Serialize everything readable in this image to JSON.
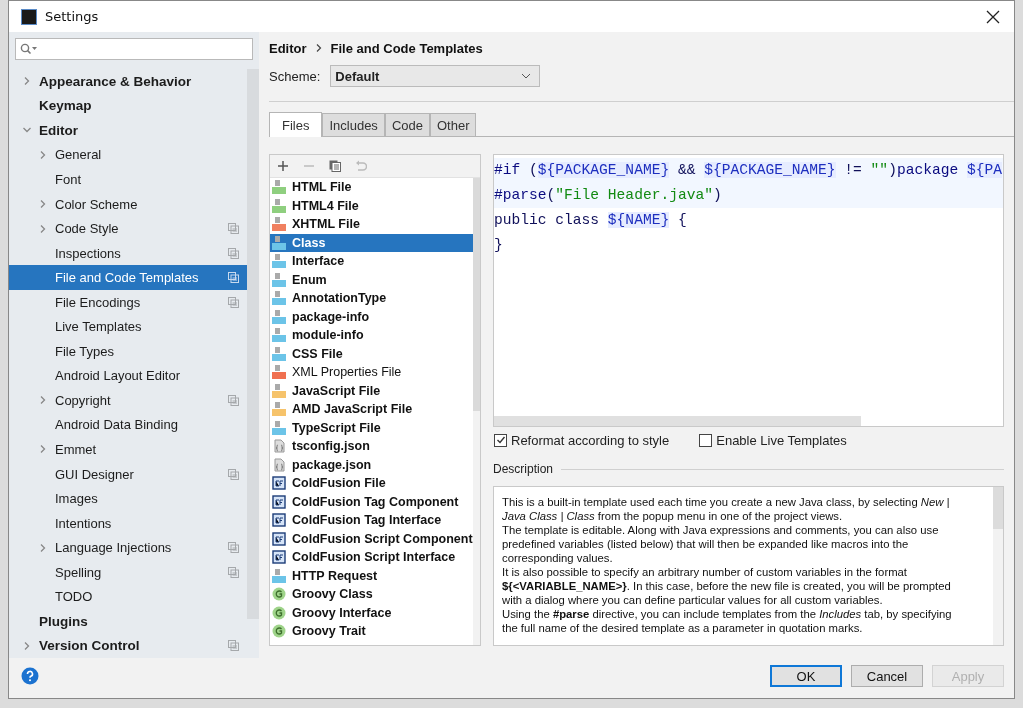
{
  "window": {
    "title": "Settings"
  },
  "sidebar": {
    "items": [
      {
        "label": "Appearance & Behavior",
        "kind": "group",
        "expanded": false,
        "bold": true,
        "project_level": false,
        "selected": false
      },
      {
        "label": "Keymap",
        "kind": "leaf",
        "bold": true,
        "project_level": false,
        "selected": false
      },
      {
        "label": "Editor",
        "kind": "group",
        "expanded": true,
        "bold": true,
        "project_level": false,
        "selected": false,
        "children": [
          {
            "label": "General",
            "kind": "group",
            "expanded": false,
            "bold": false,
            "project_level": false,
            "selected": false
          },
          {
            "label": "Font",
            "kind": "leaf",
            "bold": false,
            "project_level": false,
            "selected": false
          },
          {
            "label": "Color Scheme",
            "kind": "group",
            "expanded": false,
            "bold": false,
            "project_level": false,
            "selected": false
          },
          {
            "label": "Code Style",
            "kind": "group",
            "expanded": false,
            "bold": false,
            "project_level": true,
            "selected": false
          },
          {
            "label": "Inspections",
            "kind": "leaf",
            "bold": false,
            "project_level": true,
            "selected": false
          },
          {
            "label": "File and Code Templates",
            "kind": "leaf",
            "bold": false,
            "project_level": true,
            "selected": true
          },
          {
            "label": "File Encodings",
            "kind": "leaf",
            "bold": false,
            "project_level": true,
            "selected": false
          },
          {
            "label": "Live Templates",
            "kind": "leaf",
            "bold": false,
            "project_level": false,
            "selected": false
          },
          {
            "label": "File Types",
            "kind": "leaf",
            "bold": false,
            "project_level": false,
            "selected": false
          },
          {
            "label": "Android Layout Editor",
            "kind": "leaf",
            "bold": false,
            "project_level": false,
            "selected": false
          },
          {
            "label": "Copyright",
            "kind": "group",
            "expanded": false,
            "bold": false,
            "project_level": true,
            "selected": false
          },
          {
            "label": "Android Data Binding",
            "kind": "leaf",
            "bold": false,
            "project_level": false,
            "selected": false
          },
          {
            "label": "Emmet",
            "kind": "group",
            "expanded": false,
            "bold": false,
            "project_level": false,
            "selected": false
          },
          {
            "label": "GUI Designer",
            "kind": "leaf",
            "bold": false,
            "project_level": true,
            "selected": false
          },
          {
            "label": "Images",
            "kind": "leaf",
            "bold": false,
            "project_level": false,
            "selected": false
          },
          {
            "label": "Intentions",
            "kind": "leaf",
            "bold": false,
            "project_level": false,
            "selected": false
          },
          {
            "label": "Language Injections",
            "kind": "group",
            "expanded": false,
            "bold": false,
            "project_level": true,
            "selected": false
          },
          {
            "label": "Spelling",
            "kind": "leaf",
            "bold": false,
            "project_level": true,
            "selected": false
          },
          {
            "label": "TODO",
            "kind": "leaf",
            "bold": false,
            "project_level": false,
            "selected": false
          }
        ]
      },
      {
        "label": "Plugins",
        "kind": "leaf",
        "bold": true,
        "project_level": false,
        "selected": false
      },
      {
        "label": "Version Control",
        "kind": "group",
        "expanded": false,
        "bold": true,
        "project_level": true,
        "selected": false
      }
    ]
  },
  "breadcrumb": [
    "Editor",
    "File and Code Templates"
  ],
  "scheme": {
    "label": "Scheme:",
    "value": "Default"
  },
  "tabs": [
    {
      "label": "Files",
      "selected": true
    },
    {
      "label": "Includes",
      "selected": false
    },
    {
      "label": "Code",
      "selected": false
    },
    {
      "label": "Other",
      "selected": false
    }
  ],
  "templates": [
    {
      "name": "HTML File",
      "kind": "html",
      "bold": true,
      "selected": false
    },
    {
      "name": "HTML4 File",
      "kind": "html",
      "bold": true,
      "selected": false
    },
    {
      "name": "XHTML File",
      "kind": "xhtml",
      "bold": true,
      "selected": false
    },
    {
      "name": "Class",
      "kind": "java",
      "bold": true,
      "selected": true
    },
    {
      "name": "Interface",
      "kind": "java",
      "bold": true,
      "selected": false
    },
    {
      "name": "Enum",
      "kind": "java",
      "bold": true,
      "selected": false
    },
    {
      "name": "AnnotationType",
      "kind": "java",
      "bold": true,
      "selected": false
    },
    {
      "name": "package-info",
      "kind": "java",
      "bold": true,
      "selected": false
    },
    {
      "name": "module-info",
      "kind": "java",
      "bold": true,
      "selected": false
    },
    {
      "name": "CSS File",
      "kind": "css",
      "bold": true,
      "selected": false
    },
    {
      "name": "XML Properties File",
      "kind": "xml",
      "bold": false,
      "selected": false
    },
    {
      "name": "JavaScript File",
      "kind": "js",
      "bold": true,
      "selected": false
    },
    {
      "name": "AMD JavaScript File",
      "kind": "js",
      "bold": true,
      "selected": false
    },
    {
      "name": "TypeScript File",
      "kind": "ts",
      "bold": true,
      "selected": false
    },
    {
      "name": "tsconfig.json",
      "kind": "json",
      "bold": true,
      "selected": false
    },
    {
      "name": "package.json",
      "kind": "json",
      "bold": true,
      "selected": false
    },
    {
      "name": "ColdFusion File",
      "kind": "cf",
      "bold": true,
      "selected": false
    },
    {
      "name": "ColdFusion Tag Component",
      "kind": "cf",
      "bold": true,
      "selected": false
    },
    {
      "name": "ColdFusion Tag Interface",
      "kind": "cf",
      "bold": true,
      "selected": false
    },
    {
      "name": "ColdFusion Script Component",
      "kind": "cf",
      "bold": true,
      "selected": false
    },
    {
      "name": "ColdFusion Script Interface",
      "kind": "cf",
      "bold": true,
      "selected": false
    },
    {
      "name": "HTTP Request",
      "kind": "api",
      "bold": true,
      "selected": false
    },
    {
      "name": "Groovy Class",
      "kind": "groovy",
      "bold": true,
      "selected": false
    },
    {
      "name": "Groovy Interface",
      "kind": "groovy",
      "bold": true,
      "selected": false
    },
    {
      "name": "Groovy Trait",
      "kind": "groovy",
      "bold": true,
      "selected": false
    }
  ],
  "code": [
    {
      "highlighted": true,
      "tokens": [
        {
          "kind": "directive",
          "text": "#if"
        },
        {
          "kind": "plain",
          "text": " ("
        },
        {
          "kind": "variable",
          "text": "${PACKAGE_NAME}"
        },
        {
          "kind": "plain",
          "text": " && "
        },
        {
          "kind": "variable",
          "text": "${PACKAGE_NAME}"
        },
        {
          "kind": "plain",
          "text": " != "
        },
        {
          "kind": "string",
          "text": "\"\""
        },
        {
          "kind": "plain",
          "text": ")"
        },
        {
          "kind": "directive",
          "text": "package "
        },
        {
          "kind": "variable",
          "text": "${PA"
        }
      ]
    },
    {
      "highlighted": true,
      "tokens": [
        {
          "kind": "directive",
          "text": "#parse"
        },
        {
          "kind": "plain",
          "text": "("
        },
        {
          "kind": "string",
          "text": "\"File Header.java\""
        },
        {
          "kind": "plain",
          "text": ")"
        }
      ]
    },
    {
      "highlighted": false,
      "tokens": [
        {
          "kind": "plain",
          "text": "public class "
        },
        {
          "kind": "variable",
          "text": "${NAME}"
        },
        {
          "kind": "plain",
          "text": " {"
        }
      ]
    },
    {
      "highlighted": false,
      "tokens": [
        {
          "kind": "plain",
          "text": "}"
        }
      ]
    }
  ],
  "options": [
    {
      "label": "Reformat according to style",
      "checked": true
    },
    {
      "label": "Enable Live Templates",
      "checked": false
    }
  ],
  "description": {
    "title": "Description",
    "paragraphs": [
      "This is a built-in template used each time you create a new Java class, by selecting *New | Java Class | Class* from the popup menu in one of the project views.",
      "The template is editable. Along with Java expressions and comments, you can also use predefined variables (listed below) that will then be expanded like macros into the corresponding values.",
      "It is also possible to specify an arbitrary number of custom variables in the format **${<VARIABLE_NAME>}**. In this case, before the new file is created, you will be prompted with a dialog where you can define particular values for all custom variables.",
      "Using the **#parse** directive, you can include templates from the *Includes* tab, by specifying the full name of the desired template as a parameter in quotation marks."
    ]
  },
  "buttons": [
    {
      "label": "OK",
      "kind": "default",
      "disabled": false
    },
    {
      "label": "Cancel",
      "kind": "normal",
      "disabled": false
    },
    {
      "label": "Apply",
      "kind": "normal",
      "disabled": true
    }
  ]
}
